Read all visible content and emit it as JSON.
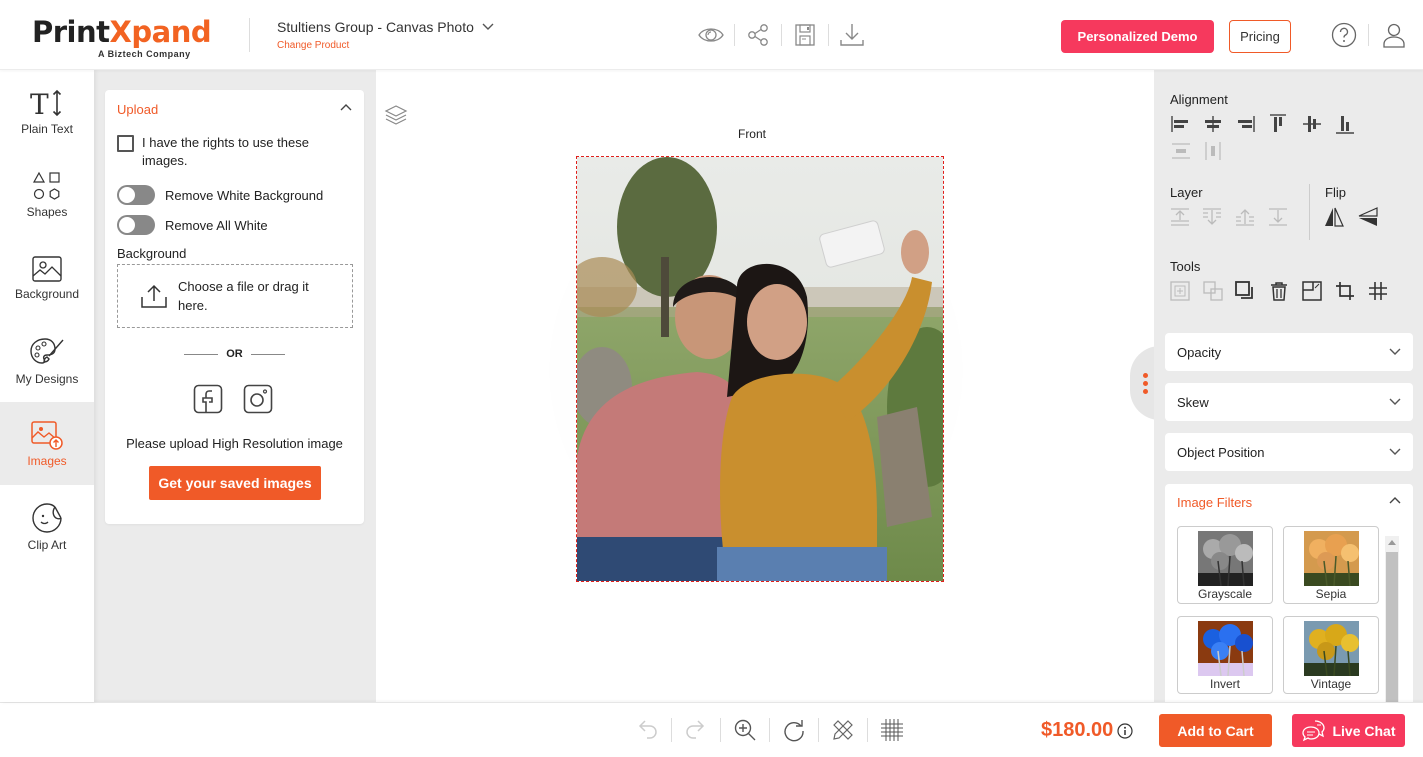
{
  "header": {
    "logo_part1": "Print",
    "logo_part2": "Xpand",
    "logo_sub": "A Biztech Company",
    "product_title": "Stultiens Group - Canvas Photo",
    "change_product": "Change Product",
    "icons": [
      "preview-eye-icon",
      "share-icon",
      "save-icon",
      "download-icon"
    ],
    "demo_button": "Personalized Demo",
    "pricing_button": "Pricing",
    "brand_color": "#f05a28",
    "accent_color": "#f6395d"
  },
  "leftnav": {
    "items": [
      {
        "label": "Plain Text",
        "icon": "text-icon",
        "active": false
      },
      {
        "label": "Shapes",
        "icon": "shapes-icon",
        "active": false
      },
      {
        "label": "Background",
        "icon": "background-image-icon",
        "active": false
      },
      {
        "label": "My Designs",
        "icon": "palette-icon",
        "active": false
      },
      {
        "label": "Images",
        "icon": "image-upload-icon",
        "active": true
      },
      {
        "label": "Clip Art",
        "icon": "sticker-icon",
        "active": false
      }
    ]
  },
  "upload": {
    "title": "Upload",
    "rights_text": "I have the rights to use these images.",
    "rights_checked": false,
    "toggle_white_bg": "Remove White Background",
    "toggle_white_bg_on": false,
    "toggle_all_white": "Remove All White",
    "toggle_all_white_on": false,
    "background_label": "Background",
    "dropzone_text": "Choose a file or drag it here.",
    "or_text": "OR",
    "hires_text": "Please upload High Resolution image",
    "saved_button": "Get your saved images"
  },
  "canvas": {
    "side_label": "Front"
  },
  "rightpanel": {
    "alignment_label": "Alignment",
    "layer_label": "Layer",
    "flip_label": "Flip",
    "tools_label": "Tools",
    "accordions": [
      "Opacity",
      "Skew",
      "Object Position"
    ],
    "filters_title": "Image Filters",
    "filters": [
      "Grayscale",
      "Sepia",
      "Invert",
      "Vintage"
    ]
  },
  "footer": {
    "price": "$180.00",
    "add_to_cart": "Add to Cart",
    "live_chat": "Live Chat"
  }
}
